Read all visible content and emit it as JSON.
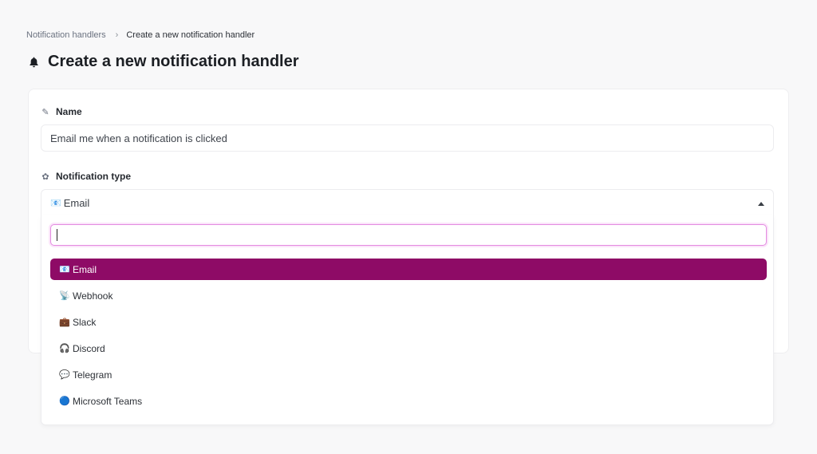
{
  "breadcrumb": {
    "parent": "Notification handlers",
    "current": "Create a new notification handler"
  },
  "page": {
    "title": "Create a new notification handler",
    "icon": "bell-icon"
  },
  "form": {
    "name_label": "Name",
    "name_icon": "signature-icon",
    "name_value": "Email me when a notification is clicked",
    "type_label": "Notification type",
    "type_icon": "brain-icon",
    "type_selected_emoji": "📧",
    "type_selected": "Email"
  },
  "dropdown": {
    "search_value": "",
    "options": [
      {
        "emoji": "📧",
        "label": "Email",
        "selected": true
      },
      {
        "emoji": "📡",
        "label": "Webhook",
        "selected": false
      },
      {
        "emoji": "💼",
        "label": "Slack",
        "selected": false
      },
      {
        "emoji": "🎧",
        "label": "Discord",
        "selected": false
      },
      {
        "emoji": "💬",
        "label": "Telegram",
        "selected": false
      },
      {
        "emoji": "🔵",
        "label": "Microsoft Teams",
        "selected": false
      }
    ]
  },
  "colors": {
    "accent": "#8e0b66",
    "focus_border": "#e38be0",
    "background": "#f8f8f9"
  }
}
